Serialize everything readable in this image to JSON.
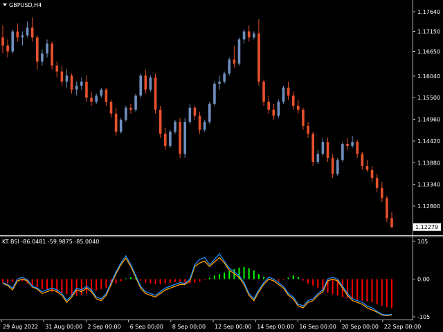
{
  "window": {
    "symbol_title": "GBPUSD,H4",
    "menu_icon": "triangle-down-icon"
  },
  "indicator": {
    "label": "KT BSI -86.0481 -59.9875 -85.0040"
  },
  "colors": {
    "background": "#000000",
    "bull_candle": "#6f8fbf",
    "bear_candle": "#e8512c",
    "grid": "#c0c0c0",
    "price_tag_bg": "#ffffff",
    "histogram_negative": "#ff0000",
    "histogram_positive": "#00ff00",
    "line_blue": "#1e90ff",
    "line_orange": "#ffa500"
  },
  "chart_data": [
    {
      "type": "candlestick",
      "title": "GBPUSD,H4",
      "y_ticks": [
        "1.17640",
        "1.17150",
        "1.16650",
        "1.16040",
        "1.15500",
        "1.14960",
        "1.14420",
        "1.13880",
        "1.13340",
        "1.12800"
      ],
      "y_tick_values": [
        1.1764,
        1.1715,
        1.1665,
        1.1604,
        1.155,
        1.1496,
        1.1442,
        1.1388,
        1.1334,
        1.128
      ],
      "current_price_label": "1.12279",
      "current_price": 1.12279,
      "ylim": [
        1.12279,
        1.1764
      ],
      "candles": [
        [
          1.17,
          1.173,
          1.166,
          1.168
        ],
        [
          1.168,
          1.1695,
          1.165,
          1.1665
        ],
        [
          1.1665,
          1.172,
          1.166,
          1.1715
        ],
        [
          1.1715,
          1.1735,
          1.169,
          1.17
        ],
        [
          1.17,
          1.1715,
          1.168,
          1.1705
        ],
        [
          1.1705,
          1.174,
          1.17,
          1.1725
        ],
        [
          1.1725,
          1.175,
          1.169,
          1.17
        ],
        [
          1.17,
          1.1705,
          1.162,
          1.164
        ],
        [
          1.164,
          1.167,
          1.163,
          1.166
        ],
        [
          1.166,
          1.1695,
          1.165,
          1.1685
        ],
        [
          1.1685,
          1.169,
          1.162,
          1.163
        ],
        [
          1.163,
          1.164,
          1.16,
          1.1615
        ],
        [
          1.1615,
          1.163,
          1.158,
          1.159
        ],
        [
          1.159,
          1.162,
          1.1575,
          1.1605
        ],
        [
          1.1605,
          1.161,
          1.156,
          1.157
        ],
        [
          1.157,
          1.159,
          1.1555,
          1.158
        ],
        [
          1.158,
          1.16,
          1.157,
          1.159
        ],
        [
          1.159,
          1.1605,
          1.154,
          1.155
        ],
        [
          1.155,
          1.1565,
          1.153,
          1.154
        ],
        [
          1.154,
          1.156,
          1.1535,
          1.1555
        ],
        [
          1.1555,
          1.1575,
          1.155,
          1.157
        ],
        [
          1.157,
          1.1575,
          1.153,
          1.154
        ],
        [
          1.154,
          1.1545,
          1.15,
          1.151
        ],
        [
          1.151,
          1.1525,
          1.1455,
          1.1465
        ],
        [
          1.1465,
          1.15,
          1.146,
          1.1495
        ],
        [
          1.1495,
          1.153,
          1.149,
          1.1525
        ],
        [
          1.1525,
          1.1535,
          1.151,
          1.152
        ],
        [
          1.152,
          1.156,
          1.1515,
          1.1555
        ],
        [
          1.1555,
          1.161,
          1.155,
          1.1605
        ],
        [
          1.1605,
          1.162,
          1.156,
          1.157
        ],
        [
          1.157,
          1.1605,
          1.1565,
          1.16
        ],
        [
          1.16,
          1.161,
          1.151,
          1.152
        ],
        [
          1.152,
          1.153,
          1.145,
          1.146
        ],
        [
          1.146,
          1.1475,
          1.142,
          1.143
        ],
        [
          1.143,
          1.147,
          1.1425,
          1.1465
        ],
        [
          1.1465,
          1.1495,
          1.146,
          1.149
        ],
        [
          1.149,
          1.15,
          1.14,
          1.141
        ],
        [
          1.141,
          1.15,
          1.14,
          1.149
        ],
        [
          1.149,
          1.1535,
          1.1485,
          1.1525
        ],
        [
          1.1525,
          1.153,
          1.1495,
          1.1505
        ],
        [
          1.1505,
          1.1515,
          1.146,
          1.147
        ],
        [
          1.147,
          1.1495,
          1.1465,
          1.149
        ],
        [
          1.149,
          1.154,
          1.1485,
          1.1535
        ],
        [
          1.1535,
          1.159,
          1.153,
          1.1585
        ],
        [
          1.1585,
          1.1605,
          1.157,
          1.159
        ],
        [
          1.159,
          1.1615,
          1.1585,
          1.161
        ],
        [
          1.161,
          1.165,
          1.1605,
          1.1645
        ],
        [
          1.1645,
          1.168,
          1.1625,
          1.1635
        ],
        [
          1.1635,
          1.17,
          1.163,
          1.1695
        ],
        [
          1.1695,
          1.172,
          1.1685,
          1.1715
        ],
        [
          1.1715,
          1.173,
          1.169,
          1.17
        ],
        [
          1.17,
          1.1715,
          1.1695,
          1.171
        ],
        [
          1.171,
          1.1745,
          1.158,
          1.159
        ],
        [
          1.159,
          1.1595,
          1.153,
          1.154
        ],
        [
          1.154,
          1.1555,
          1.151,
          1.152
        ],
        [
          1.152,
          1.1535,
          1.1495,
          1.1505
        ],
        [
          1.1505,
          1.1545,
          1.15,
          1.154
        ],
        [
          1.154,
          1.158,
          1.1535,
          1.1575
        ],
        [
          1.1575,
          1.159,
          1.1545,
          1.1555
        ],
        [
          1.1555,
          1.1565,
          1.152,
          1.153
        ],
        [
          1.153,
          1.1545,
          1.151,
          1.152
        ],
        [
          1.152,
          1.1525,
          1.147,
          1.148
        ],
        [
          1.148,
          1.149,
          1.145,
          1.146
        ],
        [
          1.146,
          1.1465,
          1.138,
          1.139
        ],
        [
          1.139,
          1.142,
          1.1385,
          1.141
        ],
        [
          1.141,
          1.145,
          1.1405,
          1.144
        ],
        [
          1.144,
          1.145,
          1.139,
          1.14
        ],
        [
          1.14,
          1.141,
          1.135,
          1.136
        ],
        [
          1.136,
          1.14,
          1.1355,
          1.1395
        ],
        [
          1.1395,
          1.144,
          1.139,
          1.1435
        ],
        [
          1.1435,
          1.145,
          1.142,
          1.143
        ],
        [
          1.143,
          1.1455,
          1.1425,
          1.144
        ],
        [
          1.144,
          1.1445,
          1.14,
          1.141
        ],
        [
          1.141,
          1.1415,
          1.137,
          1.138
        ],
        [
          1.138,
          1.1395,
          1.1365,
          1.137
        ],
        [
          1.137,
          1.138,
          1.134,
          1.135
        ],
        [
          1.135,
          1.136,
          1.1315,
          1.1325
        ],
        [
          1.1325,
          1.134,
          1.129,
          1.13
        ],
        [
          1.13,
          1.1305,
          1.124,
          1.125
        ],
        [
          1.125,
          1.1265,
          1.1225,
          1.1228
        ]
      ]
    },
    {
      "type": "indicator",
      "title": "KT BSI -86.0481 -59.9875 -85.0040",
      "y_ticks": [
        "105",
        "0.00",
        "-105"
      ],
      "y_tick_values": [
        105,
        0,
        -105
      ],
      "ylim": [
        -105,
        105
      ],
      "histogram": [
        -10,
        -12,
        -8,
        -5,
        -6,
        -12,
        -18,
        -22,
        -28,
        -30,
        -35,
        -38,
        -40,
        -42,
        -45,
        -46,
        -44,
        -40,
        -36,
        -32,
        -28,
        -24,
        -18,
        -12,
        -6,
        2,
        5,
        3,
        -4,
        -10,
        -12,
        -14,
        -14,
        -12,
        -10,
        -8,
        -8,
        -10,
        -12,
        -10,
        -6,
        -2,
        4,
        10,
        14,
        18,
        22,
        28,
        32,
        34,
        30,
        24,
        14,
        6,
        -2,
        -4,
        -6,
        -2,
        4,
        10,
        6,
        -4,
        -12,
        -18,
        -24,
        -32,
        -38,
        -42,
        -46,
        -50,
        -52,
        -55,
        -58,
        -60,
        -62,
        -65,
        -70,
        -74,
        -78,
        -80
      ],
      "x_tick_labels": [
        "29 Aug 2022",
        "31 Aug 00:00",
        "2 Sep 00:00",
        "6 Sep 00:00",
        "8 Sep 00:00",
        "12 Sep 00:00",
        "14 Sep 00:00",
        "16 Sep 00:00",
        "20 Sep 00:00",
        "22 Sep 00:00"
      ],
      "series": [
        {
          "values": [
            -10,
            -15,
            -25,
            0,
            5,
            -2,
            -20,
            -25,
            -35,
            -30,
            -25,
            -30,
            -40,
            -60,
            -45,
            -25,
            -30,
            -20,
            -30,
            -50,
            -55,
            -40,
            -10,
            20,
            45,
            65,
            40,
            10,
            -20,
            -35,
            -40,
            -45,
            -35,
            -25,
            -20,
            -15,
            -10,
            -12,
            0,
            40,
            55,
            60,
            40,
            55,
            70,
            50,
            30,
            20,
            10,
            -10,
            -40,
            -55,
            -30,
            -10,
            5,
            0,
            -10,
            -20,
            -40,
            -50,
            -70,
            -75,
            -60,
            -55,
            -40,
            -30,
            0,
            5,
            0,
            -20,
            -40,
            -55,
            -60,
            -65,
            -75,
            -80,
            -90,
            -98,
            -100,
            -98
          ]
        },
        {
          "values": [
            -12,
            -18,
            -30,
            -5,
            0,
            -5,
            -22,
            -28,
            -40,
            -35,
            -30,
            -35,
            -45,
            -65,
            -50,
            -30,
            -35,
            -25,
            -35,
            -55,
            -60,
            -45,
            -15,
            15,
            40,
            58,
            35,
            5,
            -25,
            -40,
            -45,
            -50,
            -40,
            -30,
            -25,
            -20,
            -15,
            -15,
            -5,
            35,
            45,
            50,
            35,
            48,
            60,
            45,
            25,
            15,
            5,
            -15,
            -45,
            -60,
            -35,
            -15,
            0,
            -5,
            -15,
            -25,
            -45,
            -55,
            -75,
            -80,
            -65,
            -60,
            -45,
            -35,
            -5,
            0,
            -5,
            -25,
            -45,
            -60,
            -65,
            -70,
            -80,
            -86,
            -92,
            -100,
            -102,
            -100
          ]
        }
      ]
    }
  ]
}
